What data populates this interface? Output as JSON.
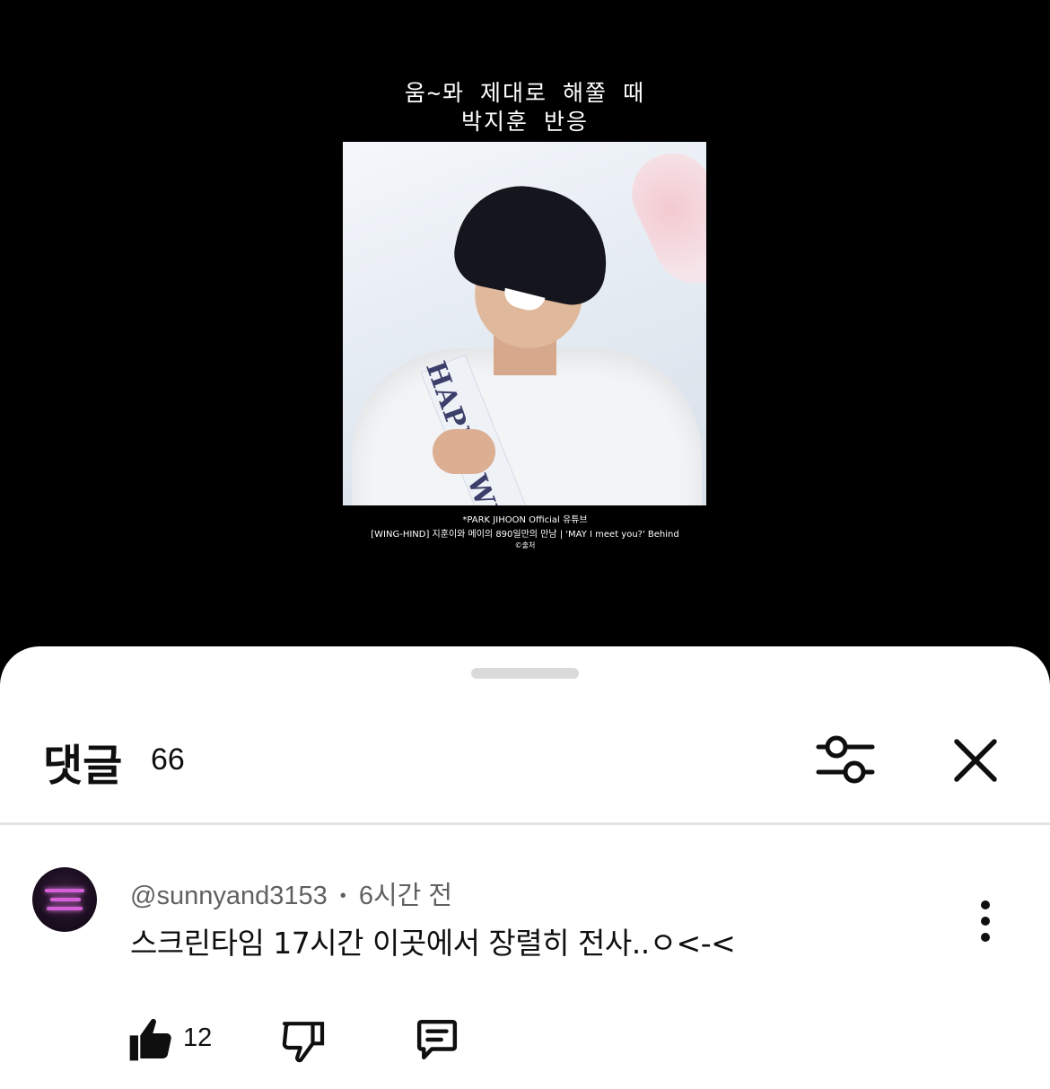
{
  "video": {
    "caption_line1": "움~뫄 제대로 해쭐 때",
    "caption_line2": "박지훈 반응",
    "credit_line1": "*PARK JIHOON Official 유튜브",
    "credit_line2": "[WING-HIND] 지훈이와 메이의 890일만의 만남 | 'MAY I meet you?' Behind",
    "credit_line3": "©출처",
    "sash_text": "HAPPY WIN"
  },
  "sheet": {
    "title": "댓글",
    "count": "66"
  },
  "comment": {
    "author": "@sunnyand3153",
    "separator": "•",
    "time": "6시간 전",
    "text": "스크린타임 17시간 이곳에서 장렬히 전사..ㅇ<-<",
    "like_count": "12"
  },
  "icons": {
    "filter": "sliders-icon",
    "close": "close-icon",
    "more": "more-vertical-icon",
    "like": "thumbs-up-icon",
    "dislike": "thumbs-down-icon",
    "reply": "reply-comment-icon"
  },
  "colors": {
    "background": "#000000",
    "sheet": "#ffffff",
    "text_primary": "#0f0f0f",
    "text_secondary": "#606060"
  }
}
